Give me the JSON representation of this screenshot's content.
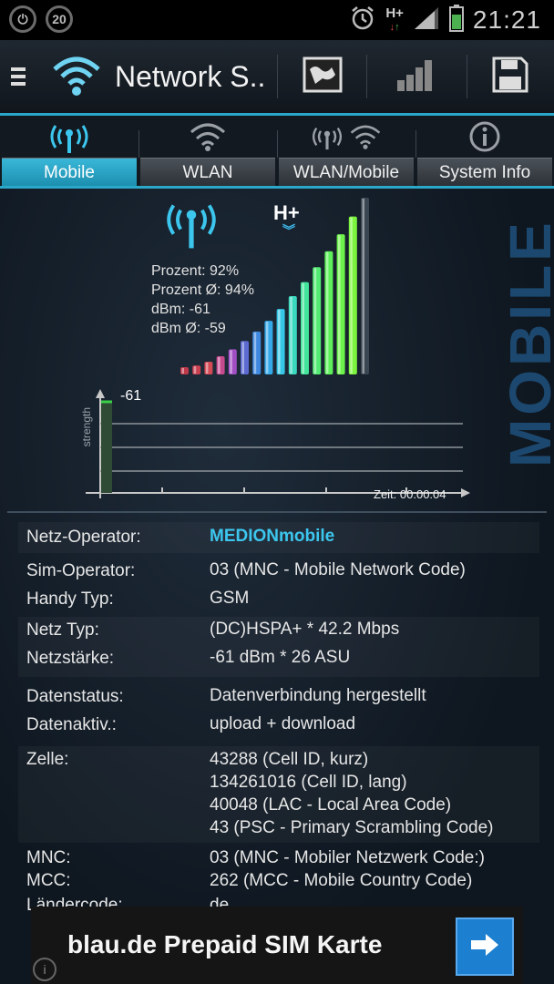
{
  "status_bar": {
    "left_badge": "20",
    "network_type": "H+",
    "time": "21:21"
  },
  "action_bar": {
    "title": "Network S.."
  },
  "tabs": [
    {
      "label": "Mobile",
      "active": true
    },
    {
      "label": "WLAN",
      "active": false
    },
    {
      "label": "WLAN/Mobile",
      "active": false
    },
    {
      "label": "System Info",
      "active": false
    }
  ],
  "signal": {
    "network_badge": "H+",
    "stats": [
      "Prozent: 92%",
      "Prozent Ø: 94%",
      "dBm: -61",
      "dBm Ø: -59"
    ],
    "side_label": "MOBILE",
    "bar_count": 16,
    "level_percent": 92
  },
  "chart": {
    "current_value": "-61",
    "y_label": "strength",
    "time_label": "Zeit: 00:00:04"
  },
  "info": [
    {
      "key": "Netz-Operator:",
      "values": [
        "MEDIONmobile"
      ]
    },
    {
      "key": "Sim-Operator:",
      "values": [
        "03 (MNC - Mobile Network Code)"
      ]
    },
    {
      "key": "Handy Typ:",
      "values": [
        "GSM"
      ]
    },
    {
      "key": "Netz Typ:",
      "values": [
        "(DC)HSPA+ * 42.2 Mbps"
      ]
    },
    {
      "key": "Netzstärke:",
      "values": [
        "-61 dBm * 26 ASU"
      ]
    },
    {
      "key": "Datenstatus:",
      "values": [
        "Datenverbindung hergestellt"
      ]
    },
    {
      "key": "Datenaktiv.:",
      "values": [
        "upload + download"
      ]
    },
    {
      "key": "Zelle:",
      "values": [
        "43288 (Cell ID, kurz)",
        "134261016 (Cell ID, lang)",
        "40048 (LAC - Local Area Code)",
        "43 (PSC - Primary Scrambling Code)"
      ]
    },
    {
      "key": "MNC:",
      "values": [
        "03 (MNC - Mobiler Netzwerk Code:)"
      ]
    },
    {
      "key": "MCC:",
      "values": [
        "262 (MCC - Mobile Country Code)"
      ]
    },
    {
      "key": "Ländercode:",
      "values": [
        "de"
      ]
    }
  ],
  "ad": {
    "text": "blau.de Prepaid SIM Karte"
  },
  "colors": {
    "accent": "#2aa7c9",
    "operator": "#3cc6ee"
  }
}
